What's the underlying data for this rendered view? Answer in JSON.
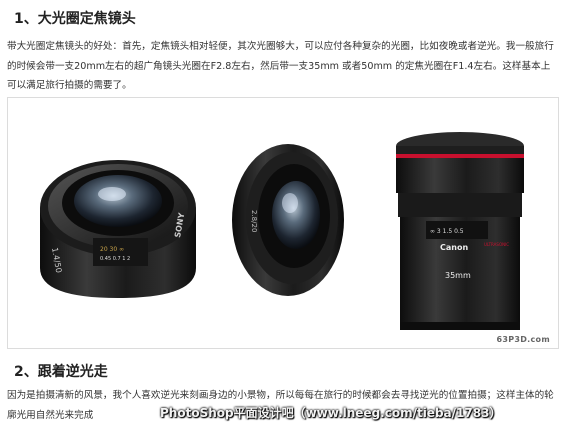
{
  "section1": {
    "heading": "1、大光圈定焦镜头",
    "paragraph": "带大光圈定焦镜头的好处：首先，定焦镜头相对轻便，其次光圈够大，可以应付各种复杂的光圈，比如夜晚或者逆光。我一般旅行的时候会带一支20mm左右的超广角镜头光圈在F2.8左右，然后带一支35mm 或者50mm 的定焦光圈在F1.4左右。这样基本上可以满足旅行拍摄的需要了。"
  },
  "figure": {
    "lens1_text": "1.4/50",
    "lens1_brand": "SONY",
    "lens2_text": "2.8/20",
    "lens3_brand": "Canon",
    "lens3_focal": "35mm",
    "lens3_series": "ULTRASONIC",
    "site_watermark": "63P3D.com"
  },
  "section2": {
    "heading": "2、跟着逆光走",
    "paragraph": "因为是拍摄清新的风景，我个人喜欢逆光来刻画身边的小景物，所以每每在旅行的时候都会去寻找逆光的位置拍摄；这样主体的轮廓光用自然光来完成"
  },
  "overlay_watermark": "PhotoShop平面设计吧（www.lneeg.com/tieba/1783）",
  "colors": {
    "red_ring": "#c8102e",
    "lens_body": "#1a1a1a"
  }
}
